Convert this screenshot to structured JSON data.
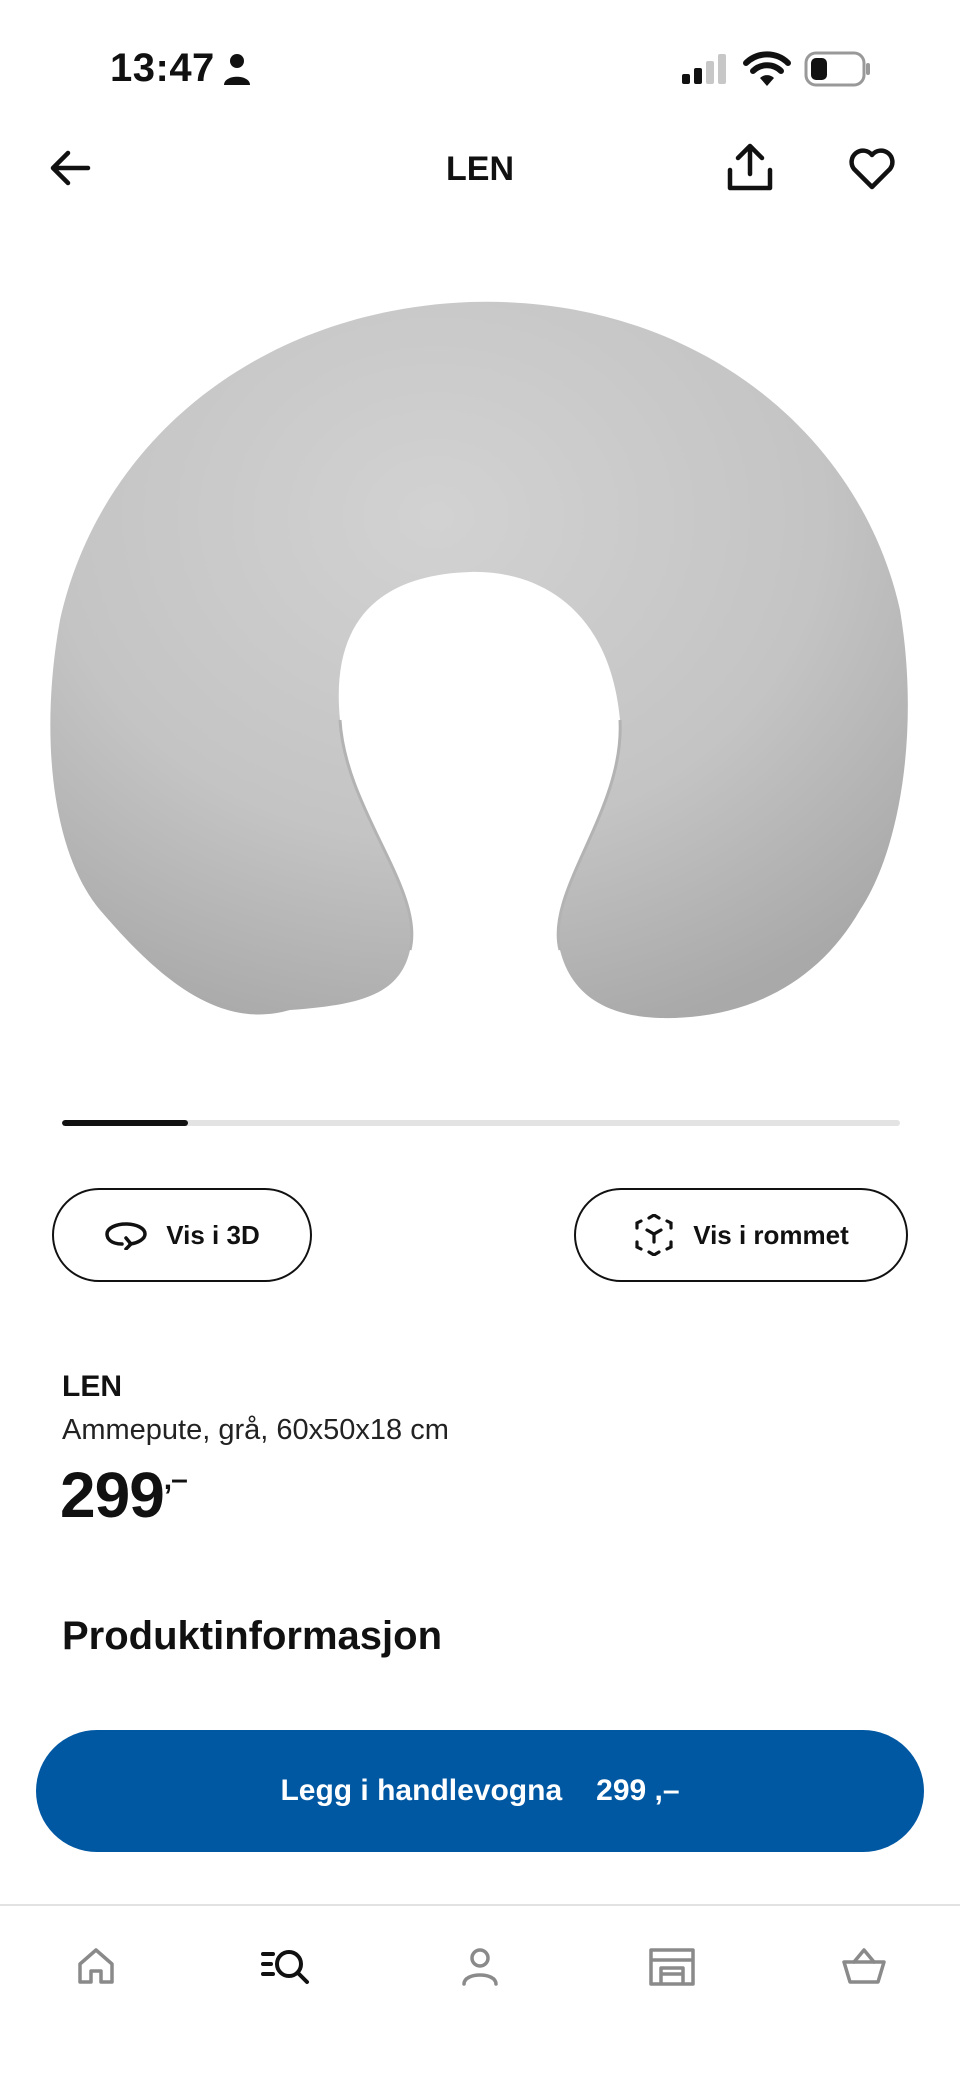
{
  "status_bar": {
    "time": "13:47"
  },
  "header": {
    "title": "LEN"
  },
  "gallery": {
    "progress": 0.15
  },
  "actions": {
    "view_3d": "Vis i 3D",
    "view_in_room": "Vis i rommet"
  },
  "product": {
    "name": "LEN",
    "description": "Ammepute, grå, 60x50x18 cm",
    "price": "299",
    "price_suffix": ",–"
  },
  "sections": {
    "product_info": "Produktinformasjon"
  },
  "cta": {
    "label": "Legg i handlevogna",
    "price": "299 ,–"
  },
  "colors": {
    "accent": "#0058a3"
  },
  "bottom_nav": {
    "items": [
      "home-icon",
      "search-catalog-icon",
      "profile-icon",
      "store-icon",
      "cart-icon"
    ],
    "active": 1
  }
}
